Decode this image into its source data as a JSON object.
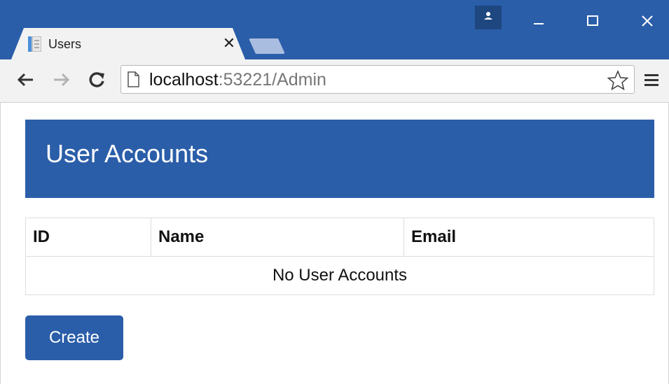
{
  "window": {
    "tab_title": "Users",
    "close_glyph": "✕",
    "icons": [
      "page-favicon-icon",
      "profile-icon",
      "minimize-icon",
      "maximize-icon",
      "close-icon"
    ]
  },
  "toolbar": {
    "url_host": "localhost",
    "url_path": ":53221/Admin",
    "icons": [
      "back-arrow-icon",
      "forward-arrow-icon",
      "reload-icon",
      "page-icon",
      "star-icon",
      "menu-icon"
    ]
  },
  "page": {
    "heading": "User Accounts",
    "table": {
      "columns": [
        "ID",
        "Name",
        "Email"
      ],
      "empty_message": "No User Accounts"
    },
    "create_label": "Create"
  },
  "colors": {
    "brand": "#2b5ea9",
    "titlebar": "#2b5ea9",
    "toolbar": "#f2f2f2"
  }
}
